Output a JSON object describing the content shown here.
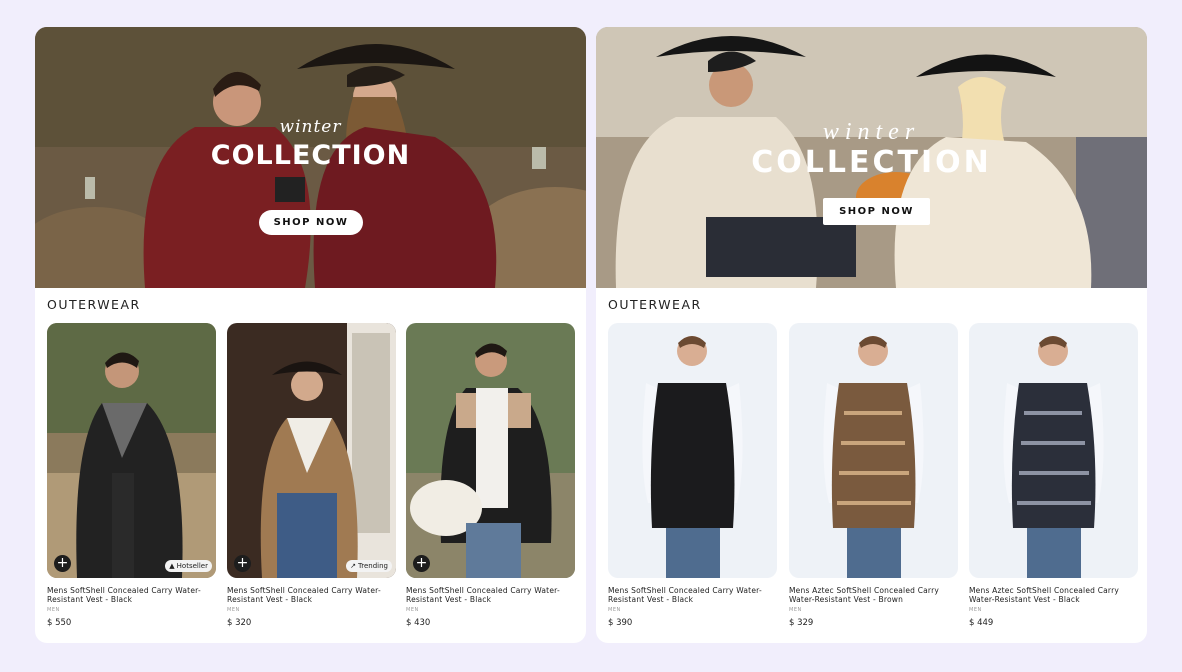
{
  "panels": [
    {
      "hero": {
        "script": "winter",
        "title": "COLLECTION",
        "cta": "SHOP NOW"
      },
      "section_title": "OUTERWEAR",
      "products": [
        {
          "name": "Mens SoftShell Concealed Carry Water-Resistant Vest - Black",
          "category": "MEN",
          "price": "$ 550",
          "badge": "Hotseller",
          "badge_icon": "flame-icon"
        },
        {
          "name": "Mens SoftShell Concealed Carry Water-Resistant Vest - Black",
          "category": "MEN",
          "price": "$ 320",
          "badge": "Trending",
          "badge_icon": "trend-icon"
        },
        {
          "name": "Mens SoftShell Concealed Carry Water-Resistant Vest - Black",
          "category": "MEN",
          "price": "$ 430"
        }
      ]
    },
    {
      "hero": {
        "script": "winter",
        "title": "COLLECTION",
        "cta": "SHOP NOW"
      },
      "section_title": "OUTERWEAR",
      "products": [
        {
          "name": "Mens SoftShell Concealed Carry Water-Resistant Vest - Black",
          "category": "MEN",
          "price": "$ 390"
        },
        {
          "name": "Mens Aztec SoftShell Concealed Carry Water-Resistant Vest - Brown",
          "category": "MEN",
          "price": "$ 329"
        },
        {
          "name": "Mens Aztec SoftShell Concealed Carry Water-Resistant Vest - Black",
          "category": "MEN",
          "price": "$ 449"
        }
      ]
    }
  ],
  "add_symbol": "+",
  "colors": {
    "page_bg": "#f1eefc",
    "card_bg": "#ffffff",
    "button_dark": "#1d1d1d"
  }
}
